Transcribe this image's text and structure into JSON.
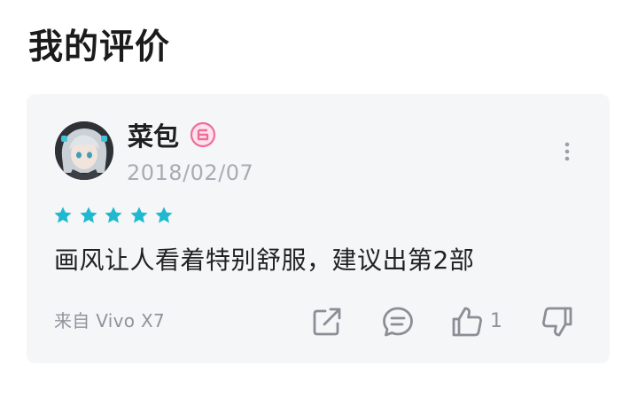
{
  "section": {
    "title": "我的评价"
  },
  "review": {
    "username": "菜包",
    "badge_icon": "level-badge-icon",
    "date": "2018/02/07",
    "rating": 5,
    "rating_max": 5,
    "text": "画风让人看着特别舒服，建议出第2部",
    "device": "来自 Vivo X7",
    "actions": {
      "share_icon": "share-icon",
      "comment_icon": "comment-icon",
      "like_icon": "thumbs-up-icon",
      "like_count": "1",
      "dislike_icon": "thumbs-down-icon"
    }
  },
  "colors": {
    "star": "#1fb9cf",
    "badge": "#f06d9a",
    "icon": "#8a8f96",
    "card_bg": "#f5f6f8"
  }
}
